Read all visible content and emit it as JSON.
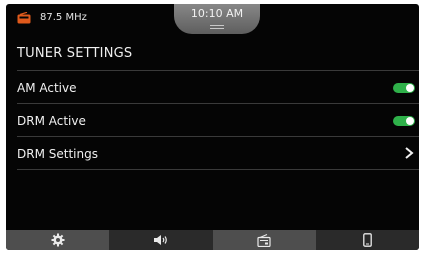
{
  "status": {
    "frequency": "87.5 MHz",
    "time": "10:10 AM",
    "source_icon": "radio-icon",
    "accent_color": "#e05a1c"
  },
  "page": {
    "title": "TUNER SETTINGS"
  },
  "settings": [
    {
      "label": "AM Active",
      "control": "toggle",
      "state": "on"
    },
    {
      "label": "DRM Active",
      "control": "toggle",
      "state": "on"
    },
    {
      "label": "DRM Settings",
      "control": "chevron-right-icon"
    }
  ],
  "toggle_on_color": "#2fb14a",
  "navbar": {
    "items": [
      {
        "icon": "gear-icon",
        "active": false
      },
      {
        "icon": "speaker-icon",
        "active": false
      },
      {
        "icon": "radio-icon",
        "active": true
      },
      {
        "icon": "phone-icon",
        "active": false
      }
    ]
  }
}
